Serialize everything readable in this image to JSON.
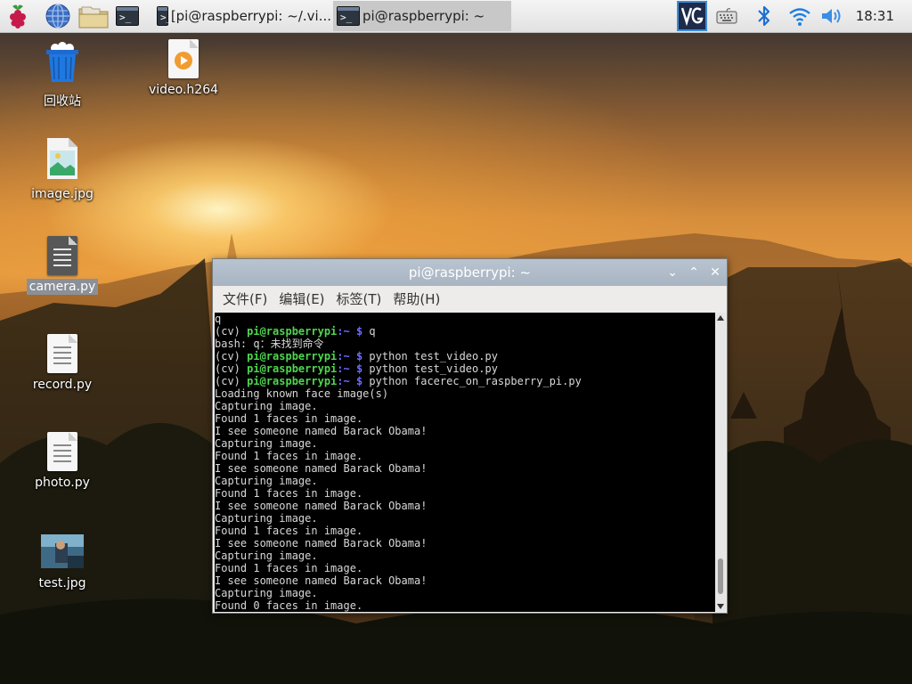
{
  "taskbar": {
    "launchers": [
      {
        "icon": "raspberry-menu-icon"
      },
      {
        "icon": "web-browser-icon"
      },
      {
        "icon": "file-manager-icon"
      },
      {
        "icon": "terminal-icon"
      }
    ],
    "tasks": [
      {
        "label": "[pi@raspberrypi: ~/.vi...",
        "active": false
      },
      {
        "label": "pi@raspberrypi: ~",
        "active": true
      }
    ],
    "tray": {
      "icons": [
        "vnc-icon",
        "keyboard-icon",
        "bluetooth-icon",
        "wifi-icon",
        "volume-icon"
      ],
      "time": "18:31"
    }
  },
  "desktop": {
    "icons": [
      {
        "label": "回收站",
        "kind": "trash",
        "selected": false
      },
      {
        "label": "video.h264",
        "kind": "video",
        "selected": false
      },
      {
        "label": "image.jpg",
        "kind": "image",
        "selected": false
      },
      {
        "label": "camera.py",
        "kind": "python",
        "selected": true
      },
      {
        "label": "record.py",
        "kind": "python",
        "selected": false
      },
      {
        "label": "photo.py",
        "kind": "python",
        "selected": false
      },
      {
        "label": "test.jpg",
        "kind": "photo",
        "selected": false
      }
    ]
  },
  "window": {
    "title": "pi@raspberrypi: ~",
    "menu": [
      "文件(F)",
      "编辑(E)",
      "标签(T)",
      "帮助(H)"
    ],
    "terminal_lines": [
      {
        "type": "text",
        "text": "q"
      },
      {
        "type": "prompt",
        "env": "(cv) ",
        "user": "pi@raspberrypi",
        "path": ":~",
        "dollar": " $ ",
        "cmd": "q"
      },
      {
        "type": "text",
        "text": "bash: q：未找到命令"
      },
      {
        "type": "prompt",
        "env": "(cv) ",
        "user": "pi@raspberrypi",
        "path": ":~",
        "dollar": " $ ",
        "cmd": "python test_video.py"
      },
      {
        "type": "prompt",
        "env": "(cv) ",
        "user": "pi@raspberrypi",
        "path": ":~",
        "dollar": " $ ",
        "cmd": "python test_video.py"
      },
      {
        "type": "prompt",
        "env": "(cv) ",
        "user": "pi@raspberrypi",
        "path": ":~",
        "dollar": " $ ",
        "cmd": "python facerec_on_raspberry_pi.py"
      },
      {
        "type": "text",
        "text": "Loading known face image(s)"
      },
      {
        "type": "text",
        "text": "Capturing image."
      },
      {
        "type": "text",
        "text": "Found 1 faces in image."
      },
      {
        "type": "text",
        "text": "I see someone named Barack Obama!"
      },
      {
        "type": "text",
        "text": "Capturing image."
      },
      {
        "type": "text",
        "text": "Found 1 faces in image."
      },
      {
        "type": "text",
        "text": "I see someone named Barack Obama!"
      },
      {
        "type": "text",
        "text": "Capturing image."
      },
      {
        "type": "text",
        "text": "Found 1 faces in image."
      },
      {
        "type": "text",
        "text": "I see someone named Barack Obama!"
      },
      {
        "type": "text",
        "text": "Capturing image."
      },
      {
        "type": "text",
        "text": "Found 1 faces in image."
      },
      {
        "type": "text",
        "text": "I see someone named Barack Obama!"
      },
      {
        "type": "text",
        "text": "Capturing image."
      },
      {
        "type": "text",
        "text": "Found 1 faces in image."
      },
      {
        "type": "text",
        "text": "I see someone named Barack Obama!"
      },
      {
        "type": "text",
        "text": "Capturing image."
      },
      {
        "type": "text",
        "text": "Found 0 faces in image."
      }
    ]
  }
}
